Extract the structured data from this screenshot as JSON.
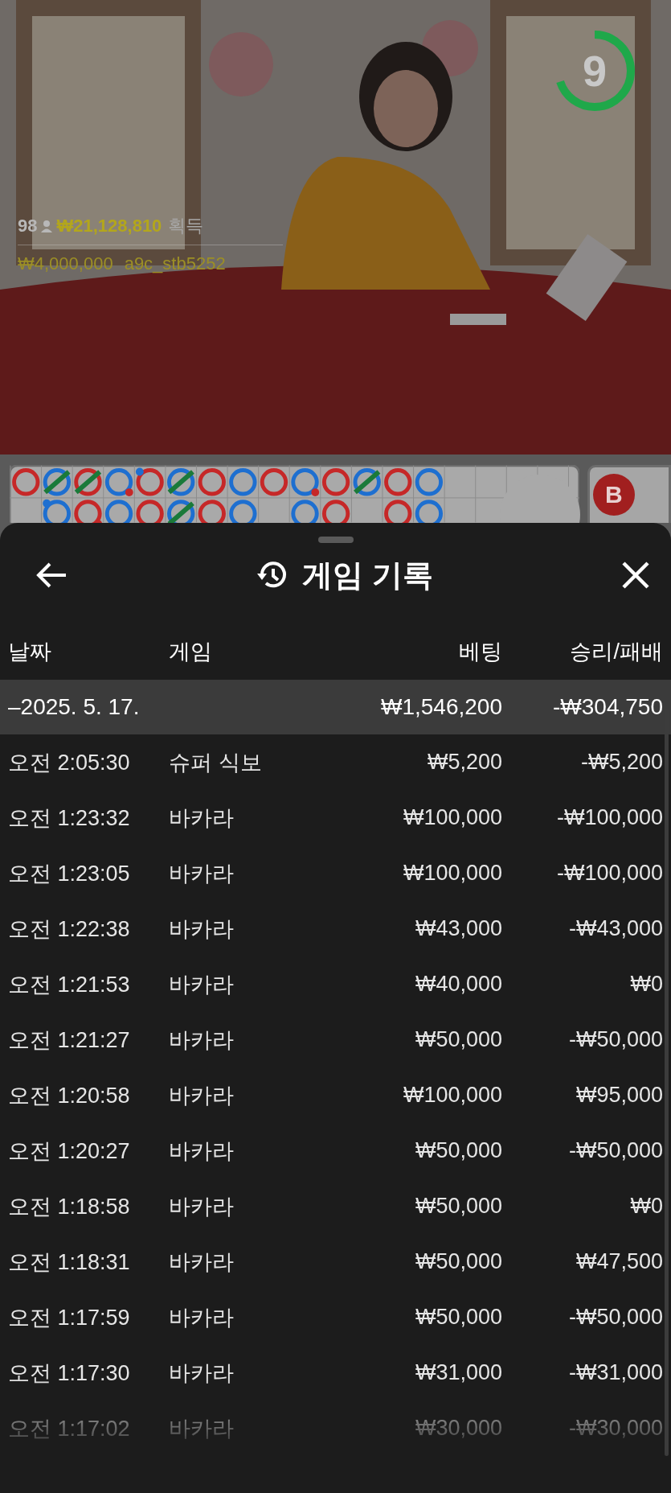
{
  "video": {
    "kind": "picture",
    "timer": {
      "count": "9",
      "level": 0.7
    },
    "winner": {
      "count": "98",
      "amount": "₩21,128,810",
      "label": "획득"
    },
    "bet": {
      "amount": "₩4,000,000",
      "user": "a9c_stb5252"
    }
  },
  "roadmap": {
    "rows": [
      [
        {
          "kind": "bead",
          "color": "#c62828",
          "tie": false,
          "player_pair": false,
          "banker_pair": false
        },
        {
          "kind": "bead",
          "color": "#1e6fd0",
          "tie": true,
          "player_pair": false,
          "banker_pair": false
        },
        {
          "kind": "bead",
          "color": "#c62828",
          "tie": true,
          "player_pair": false,
          "banker_pair": false
        },
        {
          "kind": "bead",
          "color": "#1e6fd0",
          "tie": false,
          "player_pair": false,
          "banker_pair": true
        },
        {
          "kind": "bead",
          "color": "#c62828",
          "tie": false,
          "player_pair": true,
          "banker_pair": false
        },
        {
          "kind": "bead",
          "color": "#1e6fd0",
          "tie": true,
          "player_pair": false,
          "banker_pair": false
        },
        {
          "kind": "bead",
          "color": "#c62828",
          "tie": false,
          "player_pair": false,
          "banker_pair": false
        },
        {
          "kind": "bead",
          "color": "#1e6fd0",
          "tie": false,
          "player_pair": false,
          "banker_pair": false
        },
        {
          "kind": "bead",
          "color": "#c62828",
          "tie": false,
          "player_pair": false,
          "banker_pair": false
        },
        {
          "kind": "bead",
          "color": "#1e6fd0",
          "tie": false,
          "player_pair": false,
          "banker_pair": true
        },
        {
          "kind": "bead",
          "color": "#c62828",
          "tie": false,
          "player_pair": false,
          "banker_pair": false
        },
        {
          "kind": "bead",
          "color": "#1e6fd0",
          "tie": true,
          "player_pair": false,
          "banker_pair": false
        },
        {
          "kind": "bead",
          "color": "#c62828",
          "tie": false,
          "player_pair": false,
          "banker_pair": false
        },
        {
          "kind": "bead",
          "color": "#1e6fd0",
          "tie": false,
          "player_pair": false,
          "banker_pair": false
        }
      ],
      [
        {
          "kind": "empty"
        },
        {
          "kind": "bead",
          "color": "#1e6fd0",
          "tie": false,
          "player_pair": true,
          "banker_pair": false
        },
        {
          "kind": "bead",
          "color": "#c62828",
          "tie": false,
          "player_pair": false,
          "banker_pair": true
        },
        {
          "kind": "bead",
          "color": "#1e6fd0",
          "tie": false,
          "player_pair": false,
          "banker_pair": false
        },
        {
          "kind": "bead",
          "color": "#c62828",
          "tie": false,
          "player_pair": false,
          "banker_pair": false
        },
        {
          "kind": "bead",
          "color": "#1e6fd0",
          "tie": true,
          "player_pair": false,
          "banker_pair": false
        },
        {
          "kind": "bead",
          "color": "#c62828",
          "tie": false,
          "player_pair": false,
          "banker_pair": false
        },
        {
          "kind": "bead",
          "color": "#1e6fd0",
          "tie": false,
          "player_pair": false,
          "banker_pair": false
        },
        {
          "kind": "empty"
        },
        {
          "kind": "bead",
          "color": "#1e6fd0",
          "tie": false,
          "player_pair": false,
          "banker_pair": false
        },
        {
          "kind": "bead",
          "color": "#c62828",
          "tie": false,
          "player_pair": false,
          "banker_pair": false
        },
        {
          "kind": "empty"
        },
        {
          "kind": "bead",
          "color": "#c62828",
          "tie": false,
          "player_pair": false,
          "banker_pair": false
        },
        {
          "kind": "bead",
          "color": "#1e6fd0",
          "tie": false,
          "player_pair": false,
          "banker_pair": false
        }
      ]
    ],
    "side_button": {
      "label": "B"
    }
  },
  "sheet": {
    "title": "게임 기록",
    "columns": [
      "날짜",
      "게임",
      "베팅",
      "승리/패배"
    ],
    "summary": {
      "date": "–2025. 5. 17.",
      "bet": "₩1,546,200",
      "result": "-₩304,750"
    },
    "rows": [
      {
        "time": "오전 2:05:30",
        "game": "슈퍼 식보",
        "bet": "₩5,200",
        "result": "-₩5,200"
      },
      {
        "time": "오전 1:23:32",
        "game": "바카라",
        "bet": "₩100,000",
        "result": "-₩100,000"
      },
      {
        "time": "오전 1:23:05",
        "game": "바카라",
        "bet": "₩100,000",
        "result": "-₩100,000"
      },
      {
        "time": "오전 1:22:38",
        "game": "바카라",
        "bet": "₩43,000",
        "result": "-₩43,000"
      },
      {
        "time": "오전 1:21:53",
        "game": "바카라",
        "bet": "₩40,000",
        "result": "₩0"
      },
      {
        "time": "오전 1:21:27",
        "game": "바카라",
        "bet": "₩50,000",
        "result": "-₩50,000"
      },
      {
        "time": "오전 1:20:58",
        "game": "바카라",
        "bet": "₩100,000",
        "result": "₩95,000"
      },
      {
        "time": "오전 1:20:27",
        "game": "바카라",
        "bet": "₩50,000",
        "result": "-₩50,000"
      },
      {
        "time": "오전 1:18:58",
        "game": "바카라",
        "bet": "₩50,000",
        "result": "₩0"
      },
      {
        "time": "오전 1:18:31",
        "game": "바카라",
        "bet": "₩50,000",
        "result": "₩47,500"
      },
      {
        "time": "오전 1:17:59",
        "game": "바카라",
        "bet": "₩50,000",
        "result": "-₩50,000"
      },
      {
        "time": "오전 1:17:30",
        "game": "바카라",
        "bet": "₩31,000",
        "result": "-₩31,000"
      },
      {
        "time": "오전 1:17:02",
        "game": "바카라",
        "bet": "₩30,000",
        "result": "-₩30,000"
      }
    ]
  }
}
